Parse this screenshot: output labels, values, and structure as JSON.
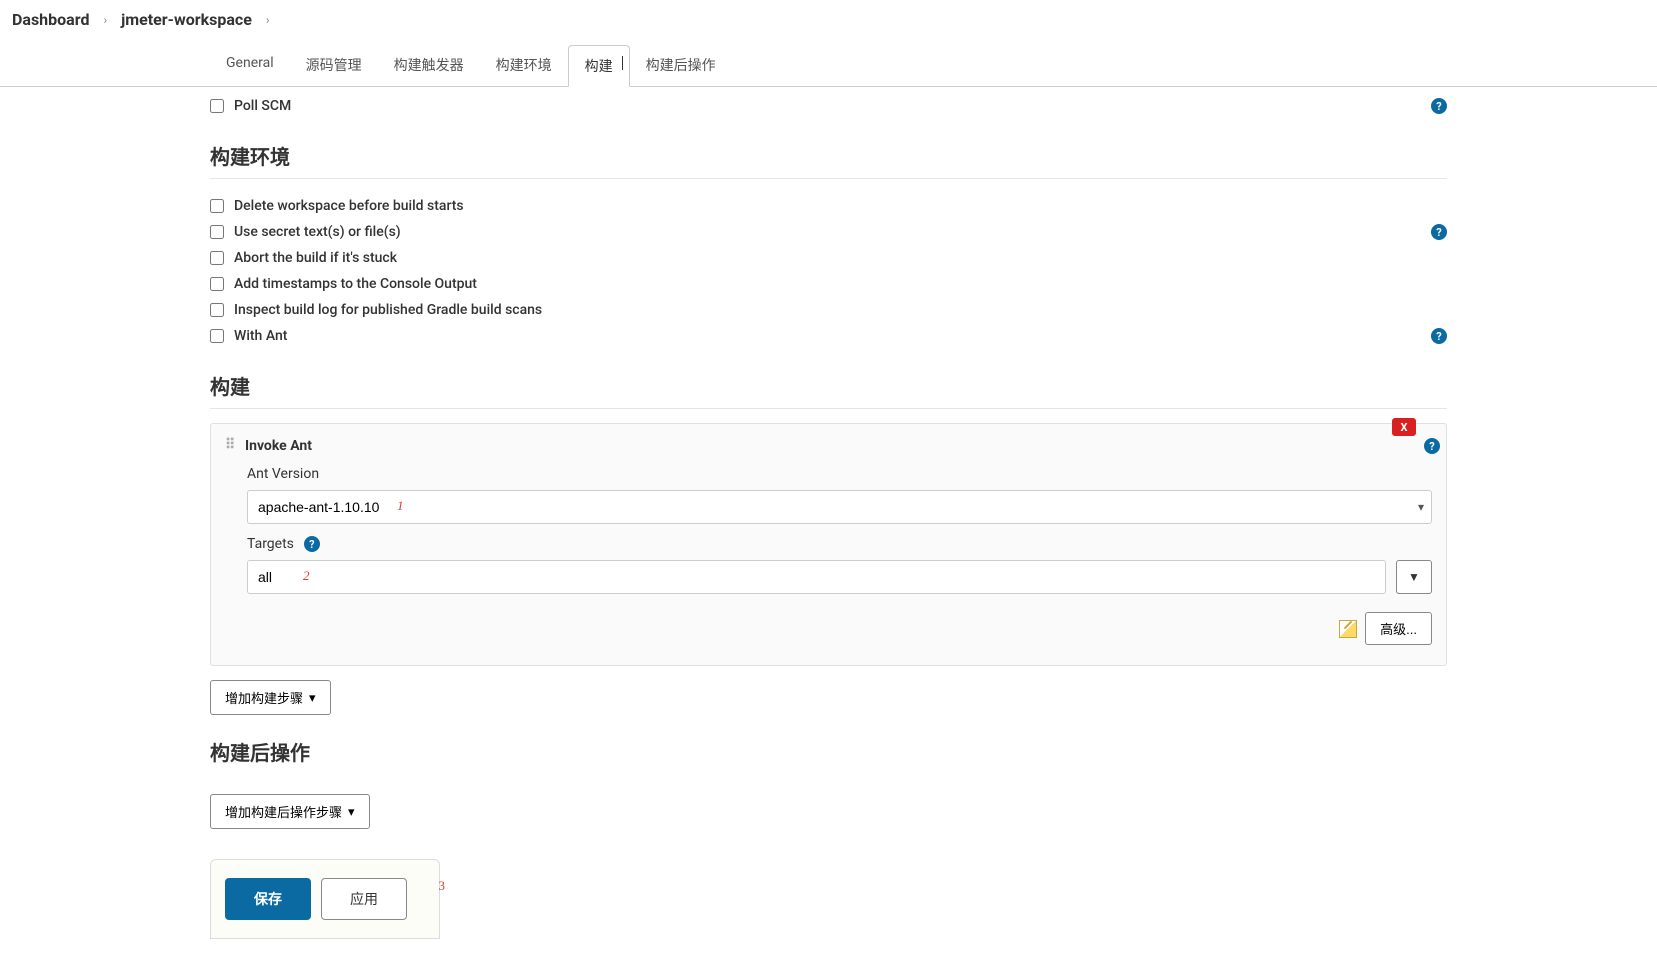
{
  "breadcrumb": {
    "dashboard": "Dashboard",
    "job": "jmeter-workspace"
  },
  "tabs": [
    {
      "label": "General"
    },
    {
      "label": "源码管理"
    },
    {
      "label": "构建触发器"
    },
    {
      "label": "构建环境"
    },
    {
      "label": "构建",
      "active": true
    },
    {
      "label": "构建后操作"
    }
  ],
  "triggers": {
    "poll_scm": "Poll SCM"
  },
  "sections": {
    "env": "构建环境",
    "build": "构建",
    "post": "构建后操作"
  },
  "env": {
    "delete_ws": "Delete workspace before build starts",
    "use_secret": "Use secret text(s) or file(s)",
    "abort_stuck": "Abort the build if it's stuck",
    "timestamps": "Add timestamps to the Console Output",
    "gradle_scan": "Inspect build log for published Gradle build scans",
    "with_ant": "With Ant"
  },
  "step": {
    "title": "Invoke Ant",
    "ant_version_label": "Ant Version",
    "ant_version_value": "apache-ant-1.10.10",
    "targets_label": "Targets",
    "targets_value": "all",
    "expand": "▼",
    "advanced": "高级...",
    "close": "X"
  },
  "buttons": {
    "add_step": "增加构建步骤",
    "add_post_step": "增加构建后操作步骤",
    "save": "保存",
    "apply": "应用"
  },
  "annotations": {
    "a1": "1",
    "a2": "2",
    "a3": "3"
  },
  "help": "?"
}
